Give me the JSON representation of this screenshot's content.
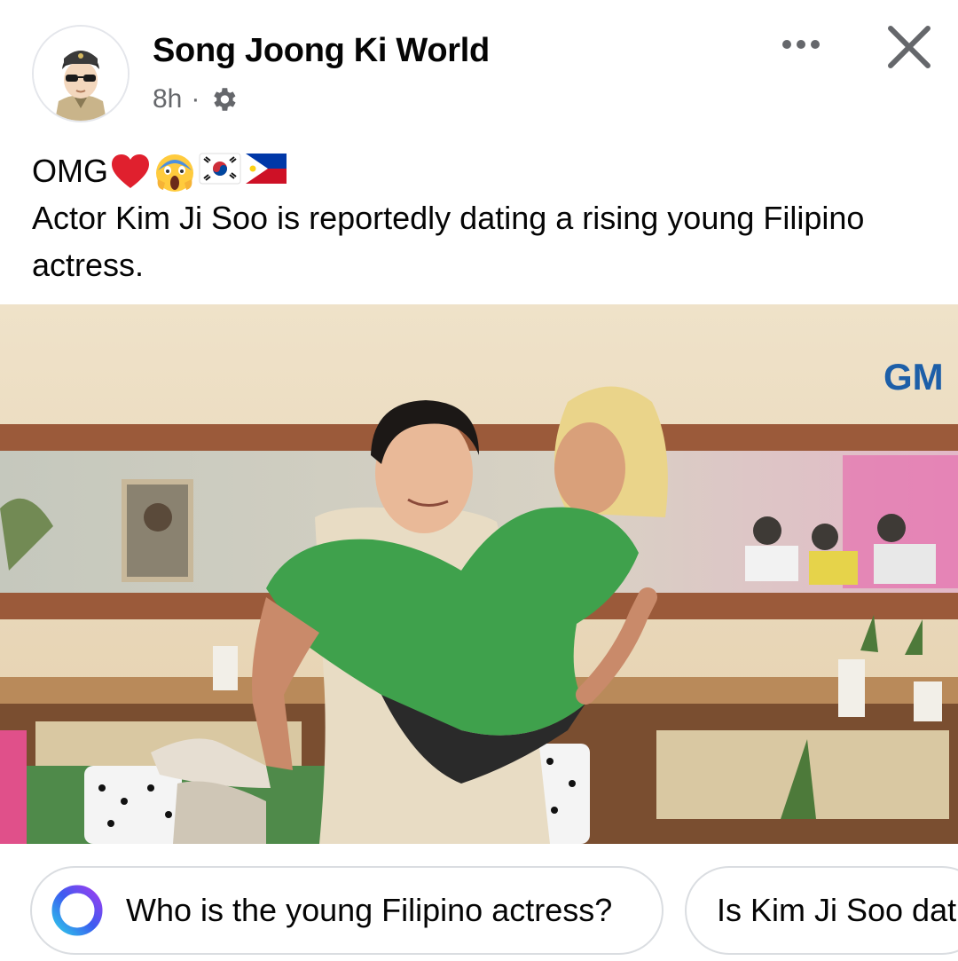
{
  "header": {
    "page_name": "Song Joong Ki World",
    "timestamp": "8h",
    "separator": "·",
    "privacy_icon": "gear-icon",
    "more_icon": "more-horizontal-icon",
    "close_icon": "close-icon"
  },
  "post": {
    "line1": "OMG",
    "emojis": [
      "red-heart-emoji",
      "screaming-face-emoji",
      "south-korea-flag",
      "philippines-flag"
    ],
    "body": "Actor Kim Ji Soo is reportedly dating a rising young Filipino actress."
  },
  "photo": {
    "watermark": "GM"
  },
  "suggestions": [
    {
      "label": "Who is the young Filipino actress?",
      "icon": "meta-ai-ring-icon"
    },
    {
      "label": "Is Kim Ji Soo dat"
    }
  ],
  "colors": {
    "secondary_text": "#65676b",
    "chip_border": "#dadde1",
    "watermark_blue": "#1d5fa8"
  }
}
